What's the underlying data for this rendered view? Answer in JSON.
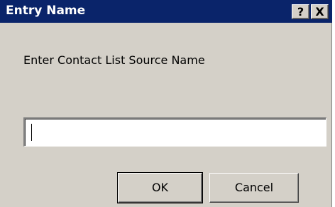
{
  "window": {
    "title": "Entry Name",
    "help_glyph": "?",
    "close_glyph": "X"
  },
  "dialog": {
    "prompt": "Enter Contact List Source Name",
    "input_value": "",
    "ok_label": "OK",
    "cancel_label": "Cancel"
  },
  "colors": {
    "titlebar": "#0a246a",
    "face": "#d4d0c8"
  }
}
